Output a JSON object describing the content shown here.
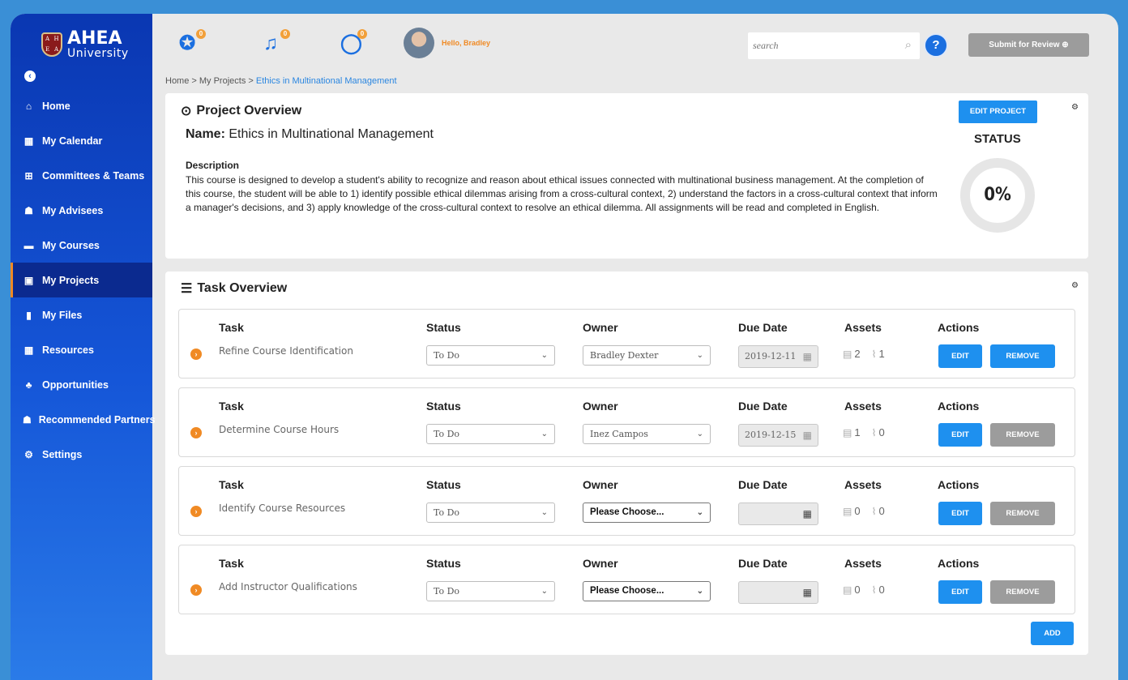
{
  "brand": {
    "name": "AHEA",
    "sub": "University",
    "shield": [
      "A",
      "H",
      "E",
      "A"
    ]
  },
  "sidebar": {
    "items": [
      {
        "label": "Home",
        "icon": "home-icon",
        "glyph": "⌂"
      },
      {
        "label": "My Calendar",
        "icon": "calendar-icon",
        "glyph": "▦"
      },
      {
        "label": "Committees & Teams",
        "icon": "committee-icon",
        "glyph": "⊞"
      },
      {
        "label": "My Advisees",
        "icon": "advisees-icon",
        "glyph": "☗"
      },
      {
        "label": "My Courses",
        "icon": "courses-icon",
        "glyph": "▬"
      },
      {
        "label": "My Projects",
        "icon": "projects-icon",
        "glyph": "▣"
      },
      {
        "label": "My Files",
        "icon": "files-icon",
        "glyph": "▮"
      },
      {
        "label": "Resources",
        "icon": "resources-icon",
        "glyph": "▦"
      },
      {
        "label": "Opportunities",
        "icon": "opportunities-icon",
        "glyph": "♣"
      },
      {
        "label": "Recommended Partners",
        "icon": "partners-icon",
        "glyph": "☗"
      },
      {
        "label": "Settings",
        "icon": "settings-icon",
        "glyph": "⚙"
      }
    ],
    "active_index": 5
  },
  "header": {
    "greeting": "Hello, Bradley",
    "search_placeholder": "search",
    "help_label": "?",
    "submit_label": "Submit for Review ⊕",
    "notifications": [
      {
        "icon": "award-icon",
        "badge": "0"
      },
      {
        "icon": "bell-icon",
        "badge": "0"
      },
      {
        "icon": "chat-icon",
        "badge": "0"
      }
    ]
  },
  "breadcrumb": {
    "trail": "Home > My Projects > ",
    "current": "Ethics in Multinational Management"
  },
  "project": {
    "section_title": "Project Overview",
    "name_label": "Name:",
    "name": "Ethics in Multinational Management",
    "description_heading": "Description",
    "description": "This course is designed to develop a student's ability to recognize and reason about ethical issues connected with multinational business management. At the completion of this course, the student will be able to 1) identify possible ethical dilemmas arising from a cross-cultural context, 2) understand the factors in a cross-cultural context that inform a manager's decisions, and 3) apply knowledge of the cross-cultural context to resolve an ethical dilemma. All assignments will be read and completed in English.",
    "edit_label": "EDIT PROJECT",
    "status_heading": "STATUS",
    "status_value": "0%"
  },
  "tasks": {
    "section_title": "Task Overview",
    "headers": {
      "task": "Task",
      "status": "Status",
      "owner": "Owner",
      "due": "Due Date",
      "assets": "Assets",
      "actions": "Actions"
    },
    "edit_label": "EDIT",
    "remove_label": "REMOVE",
    "add_label": "ADD",
    "rows": [
      {
        "name": "Refine Course Identification",
        "status": "To Do",
        "owner": "Bradley Dexter",
        "due": "2019-12-11",
        "comments": "2",
        "attachments": "1"
      },
      {
        "name": "Determine Course Hours",
        "status": "To Do",
        "owner": "Inez Campos",
        "due": "2019-12-15",
        "comments": "1",
        "attachments": "0"
      },
      {
        "name": "Identify Course Resources",
        "status": "To Do",
        "owner": "Please Choose...",
        "due": "",
        "comments": "0",
        "attachments": "0"
      },
      {
        "name": "Add Instructor Qualifications",
        "status": "To Do",
        "owner": "Please Choose...",
        "due": "",
        "comments": "0",
        "attachments": "0"
      }
    ]
  },
  "colors": {
    "sidebar": "#1556d8",
    "accent": "#1e90ef",
    "orange": "#f08a24",
    "muted_button": "#9c9c9c"
  }
}
